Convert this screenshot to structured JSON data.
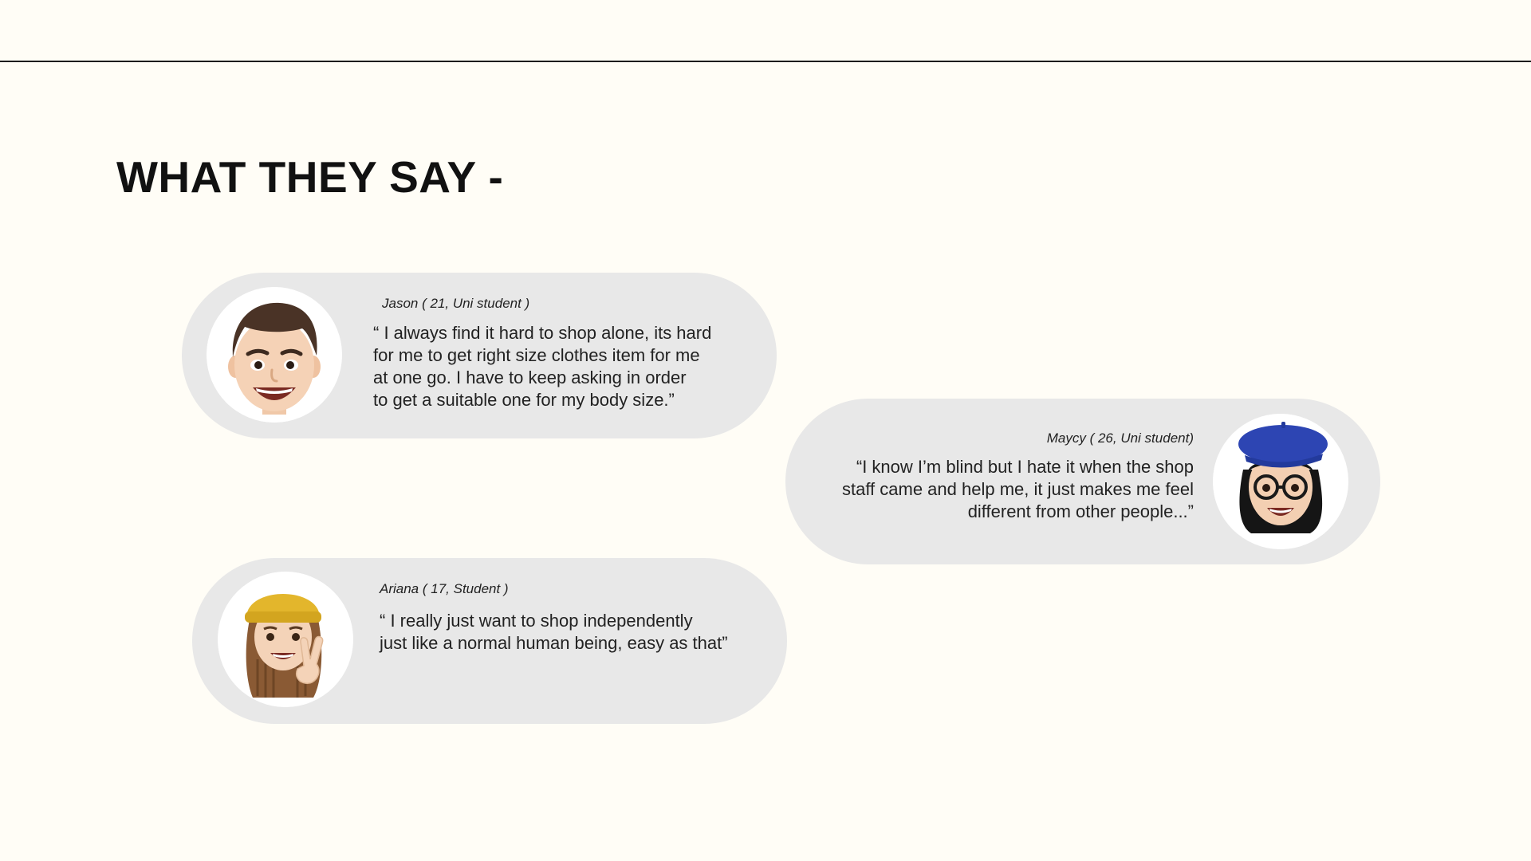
{
  "page": {
    "title": "WHAT THEY SAY -"
  },
  "colors": {
    "background": "#fffdf6",
    "bubble": "#e8e8e8",
    "rule": "#1c1c1c",
    "text": "#222222"
  },
  "testimonials": [
    {
      "speaker": "Jason ( 21, Uni student )",
      "avatar_icon": "memoji-man-smiling-icon",
      "quote_lines": [
        "“ I always find it hard to shop alone, its hard",
        "for me to get  right size clothes item for me",
        "at one go. I have to keep asking in order",
        "to get a suitable one for my body size.”"
      ]
    },
    {
      "speaker": "Maycy ( 26, Uni student)",
      "avatar_icon": "memoji-woman-beret-glasses-icon",
      "quote_lines": [
        "“I  know I’m blind but I hate it when the shop",
        "staff came and help me, it just makes me feel",
        "different from other people...”"
      ]
    },
    {
      "speaker": "Ariana ( 17, Student )",
      "avatar_icon": "memoji-girl-beanie-peace-icon",
      "quote_lines": [
        "“ I really just want to shop independently",
        "just like a normal human being, easy as that”"
      ]
    }
  ]
}
